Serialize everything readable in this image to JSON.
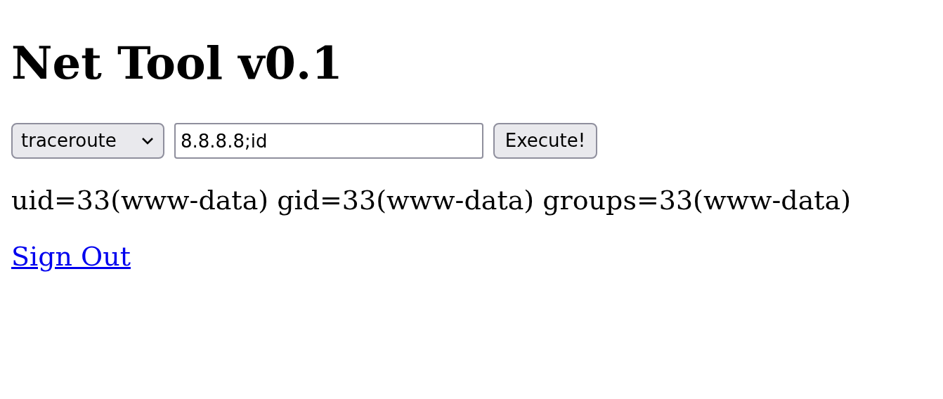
{
  "title": "Net Tool v0.1",
  "form": {
    "select": {
      "value": "traceroute"
    },
    "input": {
      "value": "8.8.8.8;id"
    },
    "button": "Execute!"
  },
  "output": "uid=33(www-data) gid=33(www-data) groups=33(www-data)",
  "link": "Sign Out"
}
